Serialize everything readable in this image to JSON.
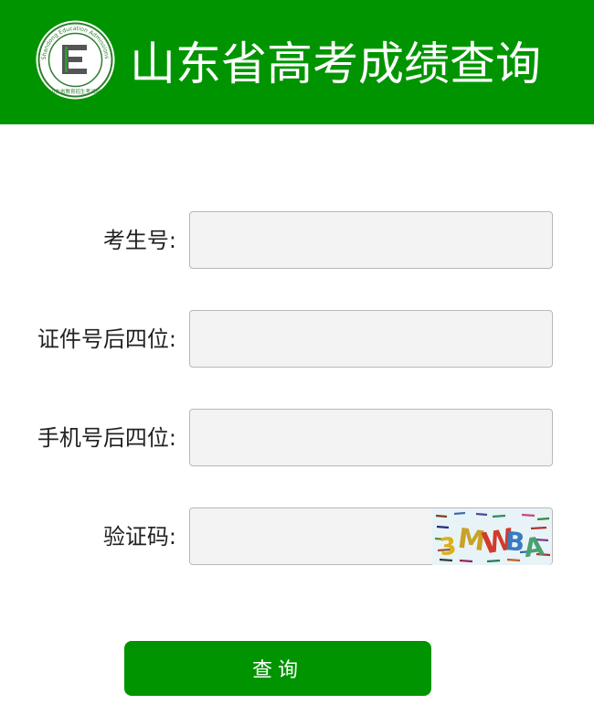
{
  "header": {
    "title": "山东省高考成绩查询",
    "logo_icon": "shandong-education-admissions-logo",
    "logo_ring_text": "Shandong Education Admissions & Examination",
    "logo_letter": "E",
    "logo_bottom_text": "山东省教育招生考试院",
    "background_color": "#009500"
  },
  "form": {
    "exam_number": {
      "label": "考生号:",
      "value": "",
      "placeholder": ""
    },
    "id_last4": {
      "label": "证件号后四位:",
      "value": "",
      "placeholder": ""
    },
    "phone_last4": {
      "label": "手机号后四位:",
      "value": "",
      "placeholder": ""
    },
    "captcha": {
      "label": "验证码:",
      "value": "",
      "placeholder": "",
      "image_text": "3MWBA"
    }
  },
  "submit": {
    "label": "查询",
    "color": "#009500"
  }
}
